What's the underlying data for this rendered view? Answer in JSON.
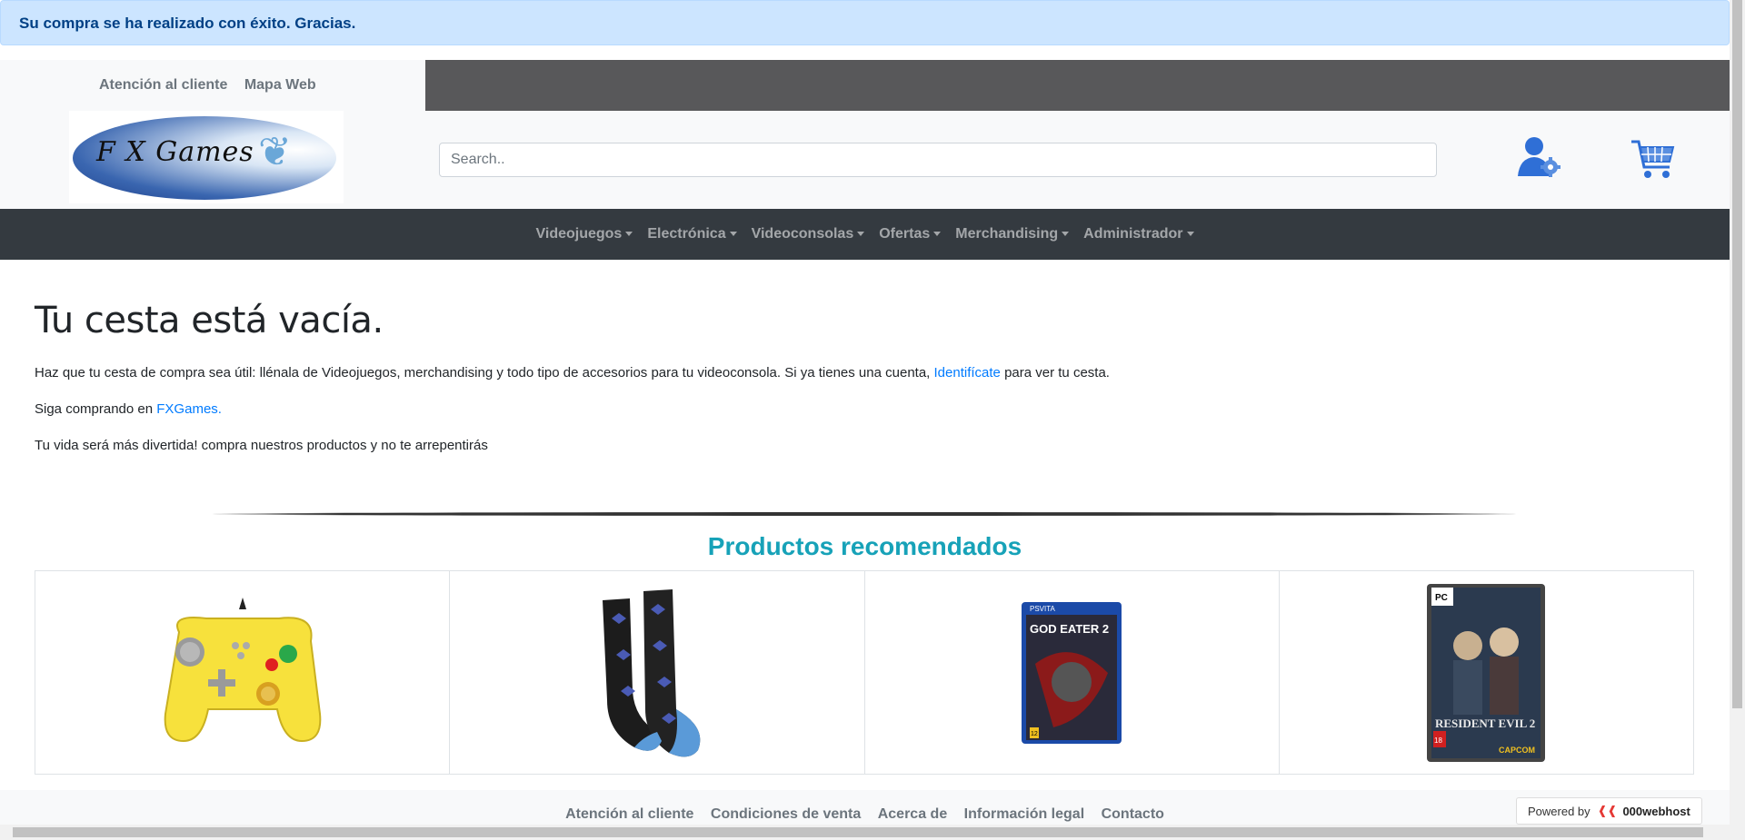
{
  "alert": {
    "message": "Su compra se ha realizado con éxito. Gracias."
  },
  "top_links": {
    "customer_service": "Atención al cliente",
    "site_map": "Mapa Web"
  },
  "logo": {
    "text": "F X Games"
  },
  "search": {
    "placeholder": "Search.."
  },
  "icons": {
    "user": "user-settings-icon",
    "cart": "shopping-cart-icon"
  },
  "nav": {
    "items": [
      {
        "label": "Videojuegos"
      },
      {
        "label": "Electrónica"
      },
      {
        "label": "Videoconsolas"
      },
      {
        "label": "Ofertas"
      },
      {
        "label": "Merchandising"
      },
      {
        "label": "Administrador"
      }
    ]
  },
  "main": {
    "title": "Tu cesta está vacía.",
    "p1_before": "Haz que tu cesta de compra sea útil: llénala de Videojuegos, merchandising y todo tipo de accesorios para tu videoconsola. Si ya tienes una cuenta, ",
    "p1_link": "Identifícate",
    "p1_after": " para ver tu cesta.",
    "p2_before": "Siga comprando en ",
    "p2_link": "FXGames.",
    "p3": "Tu vida será más divertida! compra nuestros productos y no te arrepentirás"
  },
  "recommended": {
    "title": "Productos recomendados",
    "products": [
      {
        "image": "pikachu-gamecube-controller"
      },
      {
        "image": "pokemon-socks"
      },
      {
        "image": "god-eater-2-ps-vita"
      },
      {
        "image": "resident-evil-2-pc"
      }
    ],
    "box_texts": {
      "god_eater": "GOD EATER 2",
      "resident_evil": "RESIDENT EVIL 2",
      "pc_badge": "PC",
      "psvita_badge": "PSVITA",
      "age_badge_1": "12",
      "age_badge_2": "18",
      "capcom": "CAPCOM"
    }
  },
  "footer": {
    "links": [
      {
        "label": "Atención al cliente"
      },
      {
        "label": "Condiciones de venta"
      },
      {
        "label": "Acerca de"
      },
      {
        "label": "Información legal"
      },
      {
        "label": "Contacto"
      }
    ]
  },
  "powered_by": {
    "label": "Powered by",
    "brand": "000webhost"
  },
  "colors": {
    "alert_bg": "#cce5ff",
    "navbar_bg": "#343a40",
    "title_accent": "#17a2b8",
    "link": "#007bff"
  }
}
